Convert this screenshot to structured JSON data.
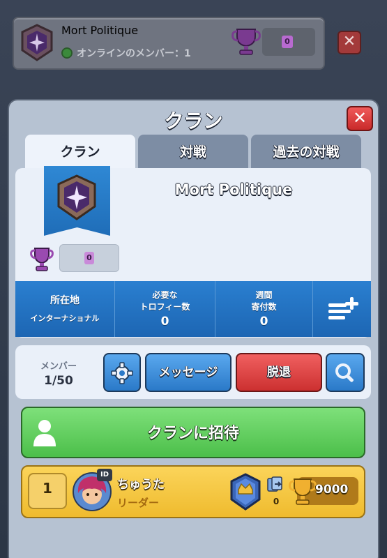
{
  "top_bar": {
    "clan_name": "Mort Politique",
    "online_text": "オンラインのメンバー：1",
    "trophies": "0"
  },
  "panel": {
    "title": "クラン",
    "tabs": [
      {
        "label": "クラン",
        "active": true
      },
      {
        "label": "対戦",
        "active": false
      },
      {
        "label": "過去の対戦",
        "active": false
      }
    ]
  },
  "clan_info": {
    "name": "Mort Politique",
    "trophies": "0",
    "stats": {
      "location_label": "所在地",
      "location_value": "インターナショナル",
      "required_trophies_label_1": "必要な",
      "required_trophies_label_2": "トロフィー数",
      "required_trophies_value": "0",
      "weekly_donations_label_1": "週間",
      "weekly_donations_label_2": "寄付数",
      "weekly_donations_value": "0"
    }
  },
  "actions": {
    "members_label": "メンバー",
    "members_count": "1/50",
    "message_label": "メッセージ",
    "leave_label": "脱退"
  },
  "invite": {
    "label": "クランに招待"
  },
  "members": [
    {
      "rank": "1",
      "id_badge": "ID",
      "name": "ちゅうた",
      "role": "リーダー",
      "donations": "0",
      "trophies": "9000"
    }
  ],
  "colors": {
    "accent_blue": "#2a79c8",
    "leave_red": "#cc3030",
    "invite_green": "#4cbf4a",
    "member_gold": "#efbb2e"
  }
}
